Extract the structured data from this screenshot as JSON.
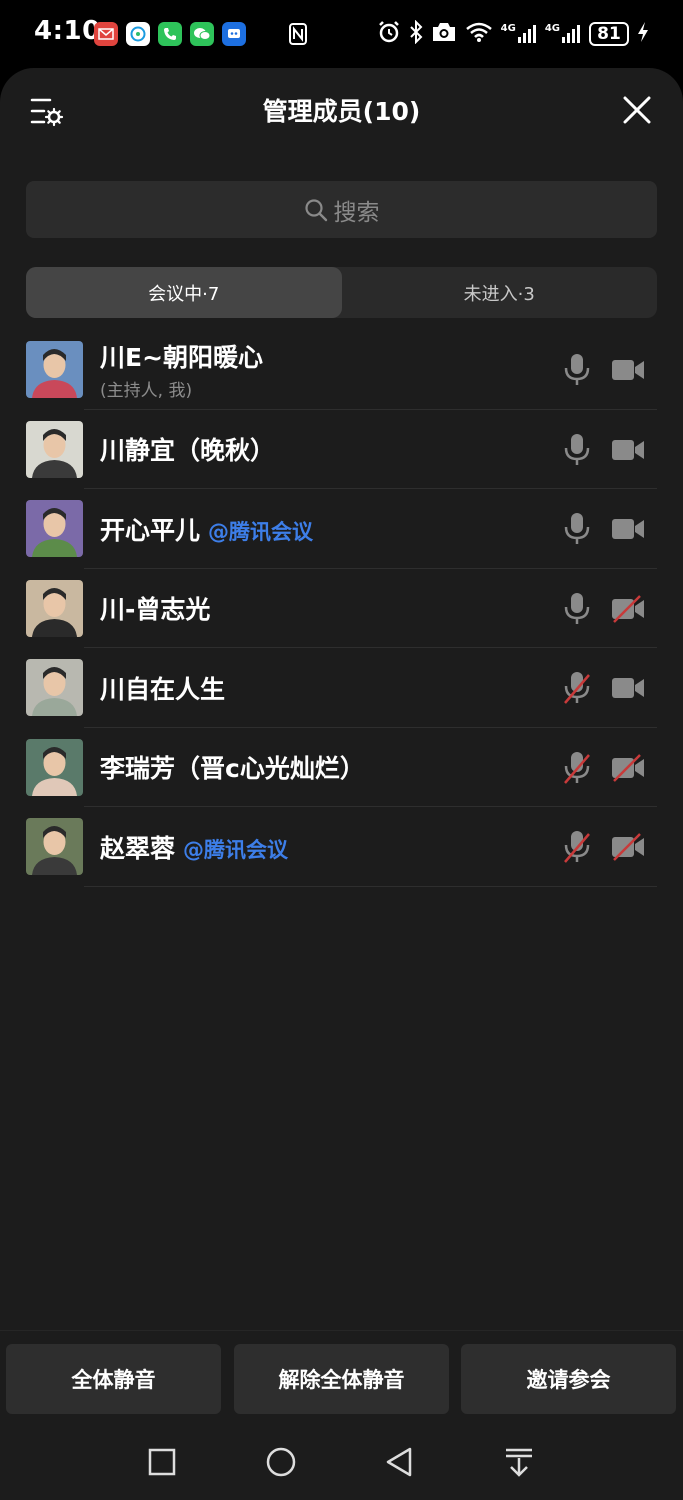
{
  "status_bar": {
    "time": "4:10",
    "battery": "81",
    "net1": "4G",
    "net2": "4G",
    "notification_icons": [
      "mail-icon",
      "chat-icon",
      "phone-icon",
      "wechat-icon",
      "app-icon"
    ]
  },
  "sheet": {
    "title": "管理成员(10)"
  },
  "search": {
    "placeholder": "搜索"
  },
  "tabs": [
    {
      "label": "会议中·7",
      "active": true
    },
    {
      "label": "未进入·3",
      "active": false
    }
  ],
  "members": [
    {
      "name": "川E~朝阳暖心",
      "tag": "",
      "sub": "(主持人, 我)",
      "mic_on": true,
      "cam_on": true
    },
    {
      "name": "川静宜（晚秋）",
      "tag": "",
      "sub": "",
      "mic_on": true,
      "cam_on": true
    },
    {
      "name": "开心平儿",
      "tag": "@腾讯会议",
      "sub": "",
      "mic_on": true,
      "cam_on": true
    },
    {
      "name": "川-曾志光",
      "tag": "",
      "sub": "",
      "mic_on": true,
      "cam_on": false
    },
    {
      "name": "川自在人生",
      "tag": "",
      "sub": "",
      "mic_on": false,
      "cam_on": true
    },
    {
      "name": "李瑞芳（晋c心光灿烂）",
      "tag": "",
      "sub": "",
      "mic_on": false,
      "cam_on": false
    },
    {
      "name": "赵翠蓉",
      "tag": "@腾讯会议",
      "sub": "",
      "mic_on": false,
      "cam_on": false
    }
  ],
  "actions": {
    "mute_all": "全体静音",
    "unmute_all": "解除全体静音",
    "invite": "邀请参会"
  },
  "colors": {
    "accent_blue": "#3d7ee8",
    "off_red": "#c83a3a",
    "sheet_bg": "#1c1c1c"
  }
}
